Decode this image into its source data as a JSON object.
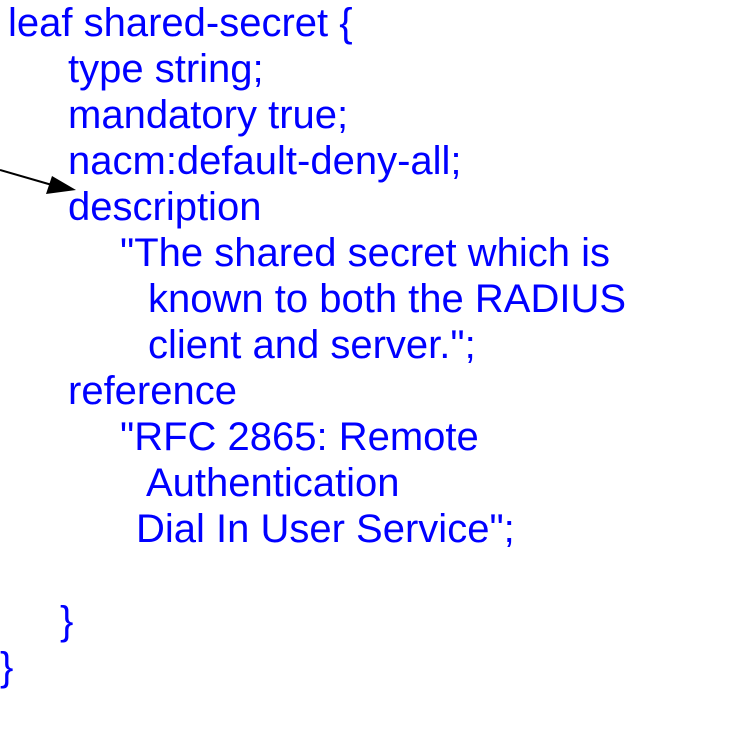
{
  "code": {
    "lines": [
      "leaf shared-secret {",
      "type string;",
      "mandatory true;",
      "nacm:default-deny-all;",
      "description",
      "\"The shared secret which is",
      "known to both the RADIUS",
      "client and server.\";",
      "reference",
      "\"RFC 2865: Remote",
      "Authentication",
      "Dial In User Service\";",
      "}",
      "}"
    ]
  },
  "colors": {
    "code_text": "#0000ff",
    "arrow": "#000000"
  },
  "icons": {
    "pointer": "arrow-pointer-icon"
  }
}
